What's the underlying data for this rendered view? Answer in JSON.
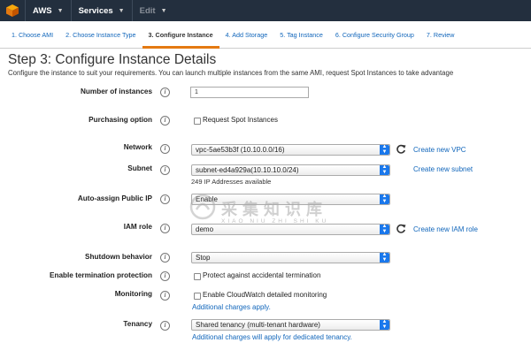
{
  "nav": {
    "brand": "AWS",
    "services": "Services",
    "edit": "Edit"
  },
  "tabs": [
    {
      "label": "1. Choose AMI",
      "active": false
    },
    {
      "label": "2. Choose Instance Type",
      "active": false
    },
    {
      "label": "3. Configure Instance",
      "active": true
    },
    {
      "label": "4. Add Storage",
      "active": false
    },
    {
      "label": "5. Tag Instance",
      "active": false
    },
    {
      "label": "6. Configure Security Group",
      "active": false
    },
    {
      "label": "7. Review",
      "active": false
    }
  ],
  "page": {
    "title": "Step 3: Configure Instance Details",
    "description": "Configure the instance to suit your requirements. You can launch multiple instances from the same AMI, request Spot Instances to take advantage"
  },
  "form": {
    "instances_label": "Number of instances",
    "instances_value": "1",
    "purchasing_label": "Purchasing option",
    "spot_label": "Request Spot Instances",
    "network_label": "Network",
    "network_value": "vpc-5ae53b3f (10.10.0.0/16)",
    "create_vpc": "Create new VPC",
    "subnet_label": "Subnet",
    "subnet_value": "subnet-ed4a929a(10.10.10.0/24)",
    "subnet_note": "249 IP Addresses available",
    "create_subnet": "Create new subnet",
    "public_ip_label": "Auto-assign Public IP",
    "public_ip_value": "Enable",
    "iam_label": "IAM role",
    "iam_value": "demo",
    "create_iam": "Create new IAM role",
    "shutdown_label": "Shutdown behavior",
    "shutdown_value": "Stop",
    "termination_label": "Enable termination protection",
    "termination_cb": "Protect against accidental termination",
    "monitoring_label": "Monitoring",
    "monitoring_cb": "Enable CloudWatch detailed monitoring",
    "monitoring_link": "Additional charges apply.",
    "tenancy_label": "Tenancy",
    "tenancy_value": "Shared tenancy (multi-tenant hardware)",
    "tenancy_link": "Additional charges will apply for dedicated tenancy."
  },
  "info_glyph": "i",
  "watermark": {
    "text": "采集知识库",
    "sub": "XIAO NIU ZHI SHI KU"
  },
  "colors": {
    "nav_bg": "#232f3e",
    "link": "#1166bb",
    "active_tab_underline": "#e47911",
    "select_arrow": "#1a78ec"
  }
}
